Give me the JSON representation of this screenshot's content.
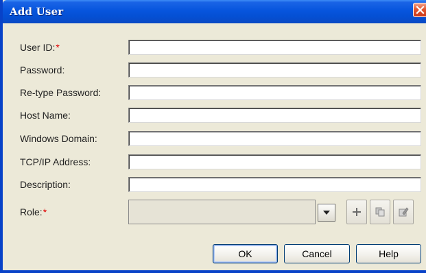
{
  "window": {
    "title": "Add User",
    "close_icon": "close-icon"
  },
  "form": {
    "required_marker": "*",
    "fields": [
      {
        "label": "User ID:",
        "required": true,
        "value": ""
      },
      {
        "label": "Password:",
        "required": false,
        "value": ""
      },
      {
        "label": "Re-type Password:",
        "required": false,
        "value": ""
      },
      {
        "label": "Host Name:",
        "required": false,
        "value": ""
      },
      {
        "label": "Windows Domain:",
        "required": false,
        "value": ""
      },
      {
        "label": "TCP/IP Address:",
        "required": false,
        "value": ""
      },
      {
        "label": "Description:",
        "required": false,
        "value": ""
      }
    ],
    "role": {
      "label": "Role:",
      "required": true,
      "selected": "",
      "dropdown_icon": "chevron-down-icon",
      "tools": [
        "add-icon",
        "copy-icon",
        "edit-icon"
      ]
    }
  },
  "buttons": {
    "ok": "OK",
    "cancel": "Cancel",
    "help": "Help"
  },
  "colors": {
    "title_bar": "#0755dd",
    "required": "#e00000",
    "window_bg": "#ece9d8"
  }
}
